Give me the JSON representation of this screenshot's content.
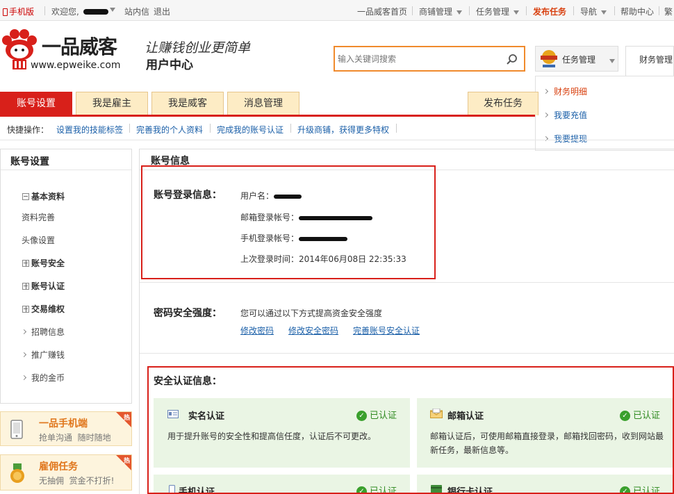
{
  "topbar": {
    "mobile": "手机版",
    "welcome": "欢迎您,",
    "messages": "站内信",
    "logout": "退出",
    "home": "一品威客首页",
    "shop_mgmt": "商铺管理",
    "task_mgmt": "任务管理",
    "publish": "发布任务",
    "nav": "导航",
    "help": "帮助中心",
    "more": "繁"
  },
  "header": {
    "logo_text": "一品威客",
    "logo_url": "www.epweike.com",
    "slogan": "让赚钱创业更简单",
    "user_center": "用户中心",
    "search_placeholder": "输入关键词搜索",
    "task_mgmt_btn": "任务管理",
    "finance_tab": "财务管理"
  },
  "finance_menu": [
    "财务明细",
    "我要充值",
    "我要提现"
  ],
  "tabs": {
    "account": "账号设置",
    "employer": "我是雇主",
    "weike": "我是威客",
    "messages": "消息管理",
    "publish": "发布任务"
  },
  "quick": {
    "label": "快捷操作：",
    "links": [
      "设置我的技能标签",
      "完善我的个人资料",
      "完成我的账号认证",
      "升级商铺，获得更多特权"
    ]
  },
  "sidebar": {
    "title": "账号设置",
    "basic": "基本资料",
    "complete": "资料完善",
    "avatar": "头像设置",
    "security": "账号安全",
    "verify": "账号认证",
    "rights": "交易维权",
    "recruit": "招聘信息",
    "promote": "推广赚钱",
    "coins": "我的金币"
  },
  "promos": [
    {
      "title": "一品手机端",
      "sub": "抢单沟通  随时随地",
      "hot": "热"
    },
    {
      "title": "雇佣任务",
      "sub": "无抽佣  赏金不打折!",
      "hot": "热"
    }
  ],
  "main": {
    "title": "账号信息",
    "login_label": "账号登录信息：",
    "username_label": "用户名：",
    "email_label": "邮箱登录帐号：",
    "phone_label": "手机登录帐号：",
    "last_login_label": "上次登录时间：",
    "last_login_value": "2014年06月08日 22:35:33",
    "pwd_label": "密码安全强度：",
    "pwd_desc": "您可以通过以下方式提高资金安全强度",
    "pwd_links": [
      "修改密码",
      "修改安全密码",
      "完善账号安全认证"
    ],
    "cert_label": "安全认证信息：",
    "cards": [
      {
        "title": "实名认证",
        "status": "已认证",
        "desc": "用于提升账号的安全性和提高信任度，认证后不可更改。"
      },
      {
        "title": "邮箱认证",
        "status": "已认证",
        "desc": "邮箱认证后，可使用邮箱直接登录，邮箱找回密码，收到网站最新任务，最新信息等。"
      },
      {
        "title": "手机认证",
        "status": "已认证"
      },
      {
        "title": "银行卡认证",
        "status": "已认证"
      }
    ]
  }
}
